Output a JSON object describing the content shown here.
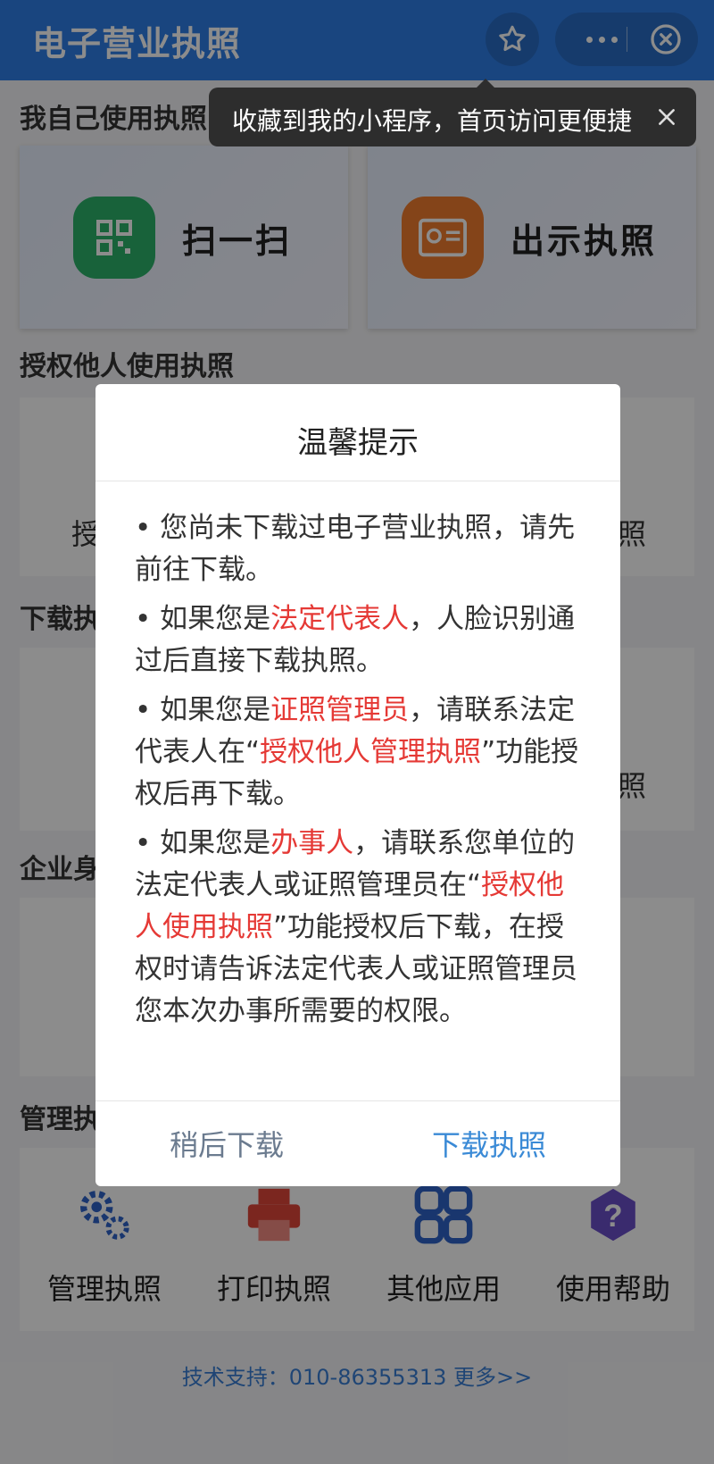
{
  "header": {
    "title": "电子营业执照"
  },
  "tooltip": {
    "text": "收藏到我的小程序，首页访问更便捷"
  },
  "sections": {
    "self_use": "我自己使用执照",
    "authorize": "授权他人使用执照",
    "download": "下载执",
    "enterprise": "企业身",
    "manage": "管理执"
  },
  "self_cards": {
    "scan": "扫一扫",
    "show": "出示执照"
  },
  "background_fragments": {
    "authorize_left": "授",
    "authorize_right": "照",
    "download_right": "照"
  },
  "manage_items": [
    {
      "label": "管理执照",
      "icon": "gears-icon"
    },
    {
      "label": "打印执照",
      "icon": "printer-icon"
    },
    {
      "label": "其他应用",
      "icon": "apps-grid-icon"
    },
    {
      "label": "使用帮助",
      "icon": "help-icon"
    }
  ],
  "footer": {
    "support": "技术支持：010-86355313    更多>>"
  },
  "modal": {
    "title": "温馨提示",
    "p1": "您尚未下载过电子营业执照，请先前往下载。",
    "p2_pre": "如果您是",
    "p2_red": "法定代表人",
    "p2_post": "，人脸识别通过后直接下载执照。",
    "p3_pre": "如果您是",
    "p3_red": "证照管理员",
    "p3_mid": "，请联系法定代表人在“",
    "p3_red2": "授权他人管理执照",
    "p3_post": "”功能授权后再下载。",
    "p4_pre": "如果您是",
    "p4_red": "办事人",
    "p4_mid": "，请联系您单位的法定代表人或证照管理员在“",
    "p4_red2": "授权他人使用执照",
    "p4_post": "”功能授权后下载，在授权时请告诉法定代表人或证照管理员您本次办事所需要的权限。",
    "bullet": "•",
    "later_button": "稍后下载",
    "download_button": "下载执照"
  },
  "colors": {
    "header": "#2f7fe8",
    "accent_red": "#e53935",
    "link_blue": "#3a8ad6"
  }
}
